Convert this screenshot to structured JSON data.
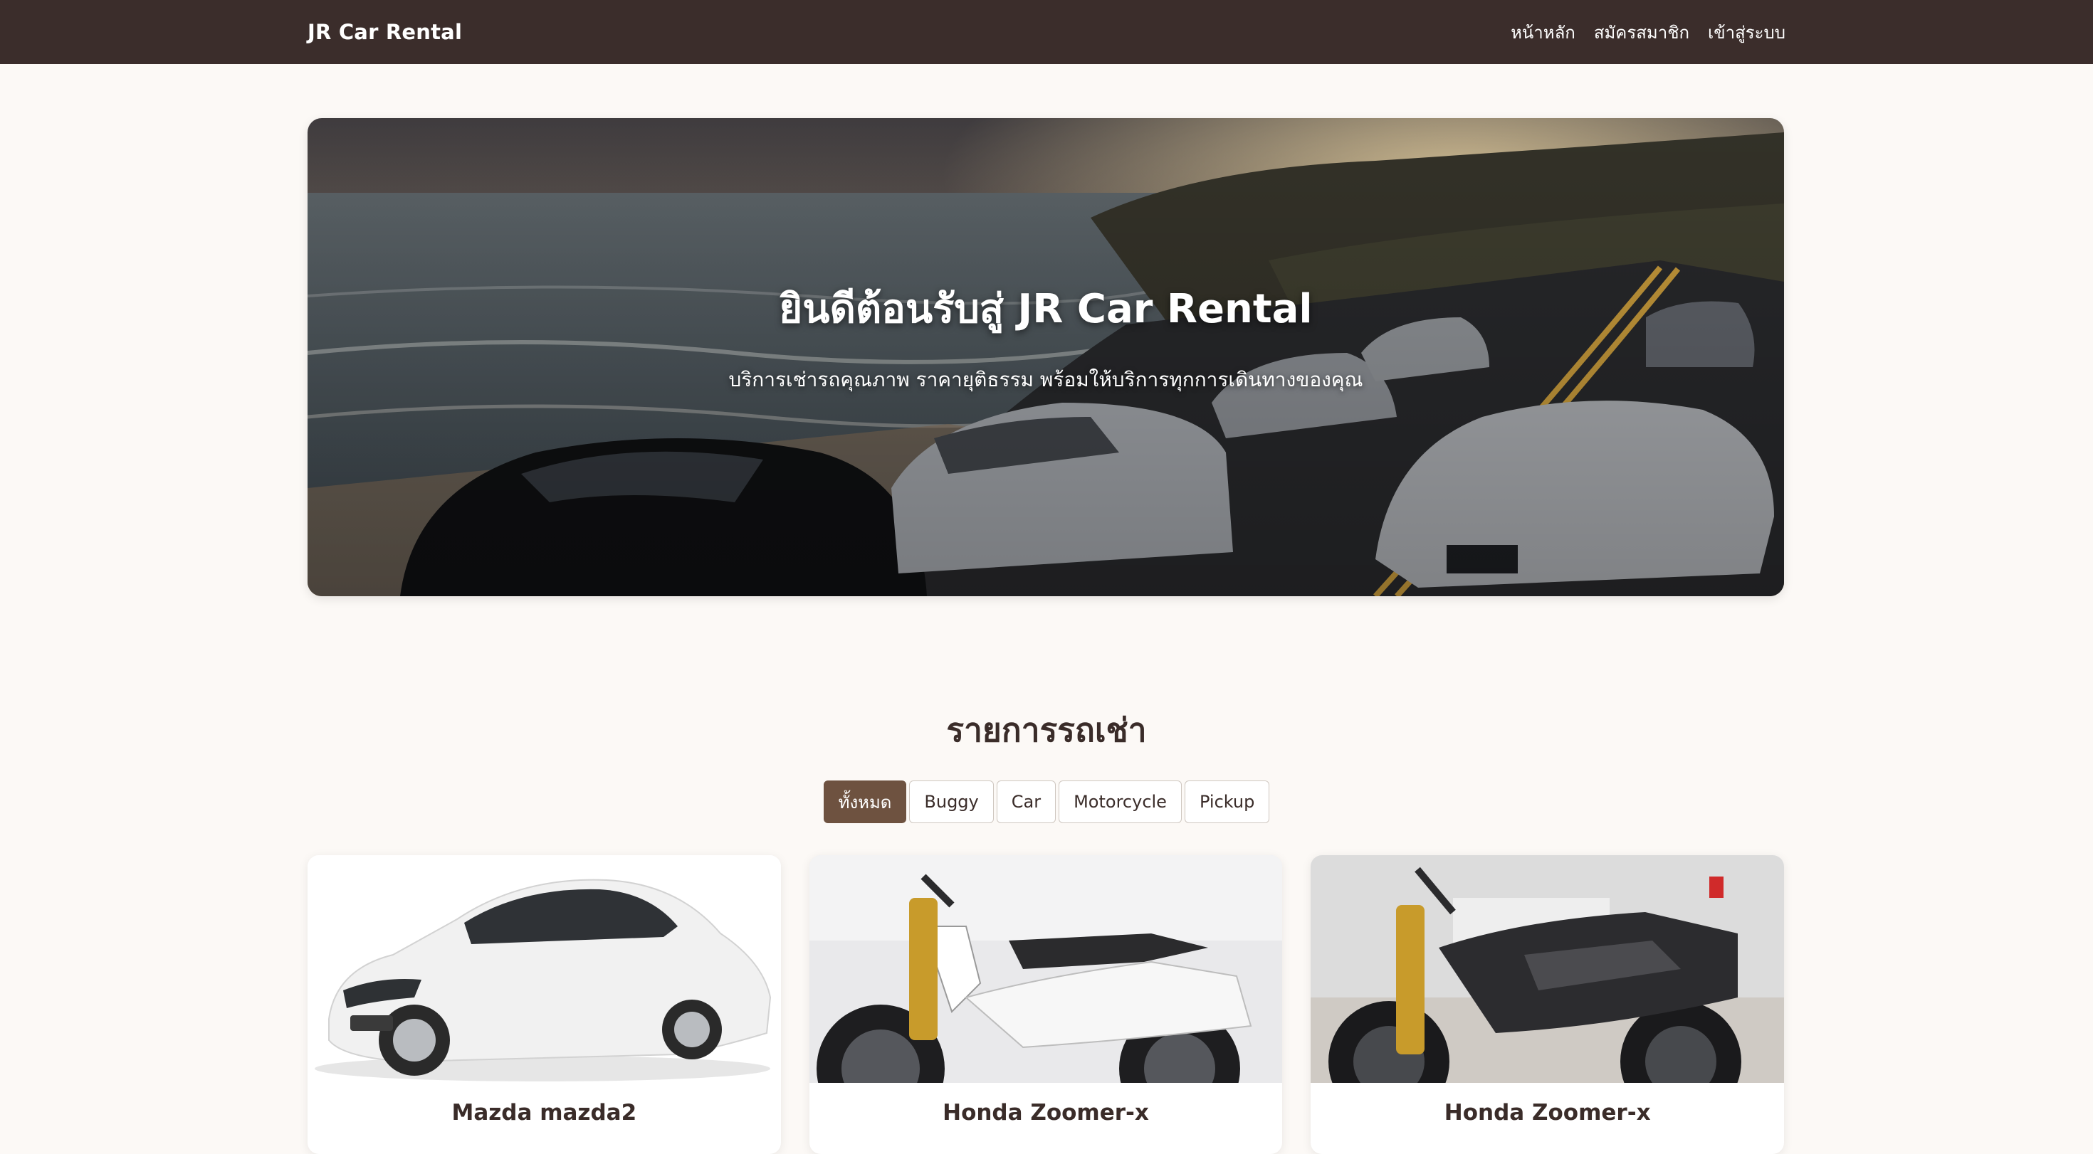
{
  "navbar": {
    "brand": "JR Car Rental",
    "links": [
      {
        "label": "หน้าหลัก"
      },
      {
        "label": "สมัครสมาชิก"
      },
      {
        "label": "เข้าสู่ระบบ"
      }
    ]
  },
  "hero": {
    "title": "ยินดีต้อนรับสู่ JR Car Rental",
    "subtitle": "บริการเช่ารถคุณภาพ ราคายุติธรรม พร้อมให้บริการทุกการเดินทางของคุณ"
  },
  "section": {
    "title": "รายการรถเช่า"
  },
  "filters": [
    {
      "label": "ทั้งหมด",
      "active": true
    },
    {
      "label": "Buggy",
      "active": false
    },
    {
      "label": "Car",
      "active": false
    },
    {
      "label": "Motorcycle",
      "active": false
    },
    {
      "label": "Pickup",
      "active": false
    }
  ],
  "cars": [
    {
      "name": "Mazda mazda2",
      "image": "white-sedan-photo"
    },
    {
      "name": "Honda Zoomer-x",
      "image": "white-scooter-photo"
    },
    {
      "name": "Honda Zoomer-x",
      "image": "black-scooter-photo"
    }
  ],
  "colors": {
    "navbar": "#3b2d2b",
    "accent": "#6e5240",
    "background": "#fcf9f6",
    "text": "#3a2c29"
  }
}
